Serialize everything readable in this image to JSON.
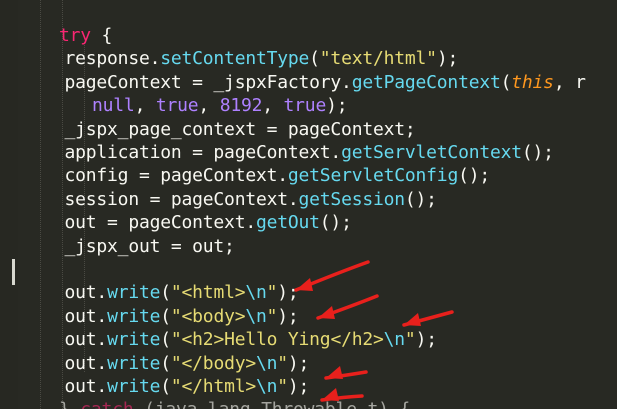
{
  "lines": [
    {
      "indent": 3,
      "t": [
        {
          "c": "kw",
          "v": "try"
        },
        {
          "c": "pl",
          "v": " {"
        }
      ]
    },
    {
      "indent": 4,
      "t": [
        {
          "c": "pl",
          "v": "response."
        },
        {
          "c": "fn",
          "v": "setContentType"
        },
        {
          "c": "pl",
          "v": "("
        },
        {
          "c": "str",
          "v": "\"text/html\""
        },
        {
          "c": "pl",
          "v": ");"
        }
      ]
    },
    {
      "indent": 4,
      "t": [
        {
          "c": "pl",
          "v": "pageContext = _jspxFactory."
        },
        {
          "c": "fn",
          "v": "getPageContext"
        },
        {
          "c": "pl",
          "v": "("
        },
        {
          "c": "this",
          "v": "this"
        },
        {
          "c": "pl",
          "v": ", r"
        }
      ]
    },
    {
      "indent": 9,
      "t": [
        {
          "c": "num",
          "v": "null"
        },
        {
          "c": "pl",
          "v": ", "
        },
        {
          "c": "num",
          "v": "true"
        },
        {
          "c": "pl",
          "v": ", "
        },
        {
          "c": "num",
          "v": "8192"
        },
        {
          "c": "pl",
          "v": ", "
        },
        {
          "c": "num",
          "v": "true"
        },
        {
          "c": "pl",
          "v": ");"
        }
      ]
    },
    {
      "indent": 4,
      "t": [
        {
          "c": "pl",
          "v": "_jspx_page_context = pageContext;"
        }
      ]
    },
    {
      "indent": 4,
      "t": [
        {
          "c": "pl",
          "v": "application = pageContext."
        },
        {
          "c": "fn",
          "v": "getServletContext"
        },
        {
          "c": "pl",
          "v": "();"
        }
      ]
    },
    {
      "indent": 4,
      "t": [
        {
          "c": "pl",
          "v": "config = pageContext."
        },
        {
          "c": "fn",
          "v": "getServletConfig"
        },
        {
          "c": "pl",
          "v": "();"
        }
      ]
    },
    {
      "indent": 4,
      "t": [
        {
          "c": "pl",
          "v": "session = pageContext."
        },
        {
          "c": "fn",
          "v": "getSession"
        },
        {
          "c": "pl",
          "v": "();"
        }
      ]
    },
    {
      "indent": 4,
      "t": [
        {
          "c": "pl",
          "v": "out = pageContext."
        },
        {
          "c": "fn",
          "v": "getOut"
        },
        {
          "c": "pl",
          "v": "();"
        }
      ]
    },
    {
      "indent": 4,
      "t": [
        {
          "c": "pl",
          "v": "_jspx_out = out;"
        }
      ]
    },
    {
      "indent": 0,
      "t": []
    },
    {
      "indent": 4,
      "t": [
        {
          "c": "pl",
          "v": "out."
        },
        {
          "c": "fn",
          "v": "write"
        },
        {
          "c": "pl",
          "v": "("
        },
        {
          "c": "str",
          "v": "\"<html>"
        },
        {
          "c": "fn",
          "v": "\\n"
        },
        {
          "c": "str",
          "v": "\""
        },
        {
          "c": "pl",
          "v": ");"
        }
      ]
    },
    {
      "indent": 4,
      "t": [
        {
          "c": "pl",
          "v": "out."
        },
        {
          "c": "fn",
          "v": "write"
        },
        {
          "c": "pl",
          "v": "("
        },
        {
          "c": "str",
          "v": "\"<body>"
        },
        {
          "c": "fn",
          "v": "\\n"
        },
        {
          "c": "str",
          "v": "\""
        },
        {
          "c": "pl",
          "v": ");"
        }
      ]
    },
    {
      "indent": 4,
      "t": [
        {
          "c": "pl",
          "v": "out."
        },
        {
          "c": "fn",
          "v": "write"
        },
        {
          "c": "pl",
          "v": "("
        },
        {
          "c": "str",
          "v": "\"<h2>Hello Ying</h2>"
        },
        {
          "c": "fn",
          "v": "\\n"
        },
        {
          "c": "str",
          "v": "\""
        },
        {
          "c": "pl",
          "v": ");"
        }
      ]
    },
    {
      "indent": 4,
      "t": [
        {
          "c": "pl",
          "v": "out."
        },
        {
          "c": "fn",
          "v": "write"
        },
        {
          "c": "pl",
          "v": "("
        },
        {
          "c": "str",
          "v": "\"</body>"
        },
        {
          "c": "fn",
          "v": "\\n"
        },
        {
          "c": "str",
          "v": "\""
        },
        {
          "c": "pl",
          "v": ");"
        }
      ]
    },
    {
      "indent": 4,
      "t": [
        {
          "c": "pl",
          "v": "out."
        },
        {
          "c": "fn",
          "v": "write"
        },
        {
          "c": "pl",
          "v": "("
        },
        {
          "c": "str",
          "v": "\"</html>"
        },
        {
          "c": "fn",
          "v": "\\n"
        },
        {
          "c": "str",
          "v": "\""
        },
        {
          "c": "pl",
          "v": ");"
        }
      ]
    },
    {
      "indent": 3,
      "faded": true,
      "t": [
        {
          "c": "pl",
          "v": "} "
        },
        {
          "c": "kw",
          "v": "catch"
        },
        {
          "c": "pl",
          "v": " (java.lang.Throwable t) {"
        }
      ]
    }
  ],
  "theme": {
    "background": "#282923",
    "plain": "#f8f8f2",
    "keyword": "#f92672",
    "function": "#66d9ef",
    "string": "#e6db74",
    "constant": "#ae81ff",
    "this": "#fd971f",
    "annotation_arrow": "#e8201c"
  }
}
